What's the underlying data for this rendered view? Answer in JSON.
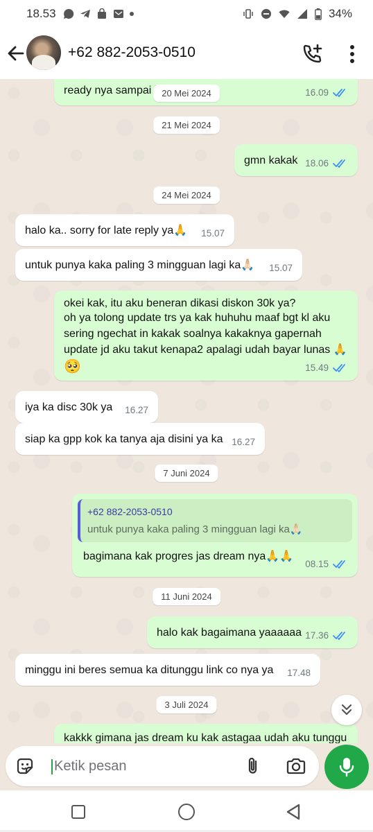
{
  "status_bar": {
    "time": "18.53",
    "battery": "34%"
  },
  "header": {
    "contact": "+62 882-2053-0510"
  },
  "dates": {
    "d1": "20 Mei 2024",
    "d2": "21 Mei 2024",
    "d3": "24 Mei 2024",
    "d4": "7 Juni 2024",
    "d5": "11 Juni 2024",
    "d6": "3 Juli 2024"
  },
  "messages": [
    {
      "dir": "out",
      "text": "ready nya sampai kapan?",
      "time": "16.09"
    },
    {
      "dir": "out",
      "text": "gmn kakak",
      "time": "18.06"
    },
    {
      "dir": "in",
      "text": "halo ka.. sorry for late reply ya🙏",
      "time": "15.07"
    },
    {
      "dir": "in",
      "text": "untuk punya kaka paling 3 mingguan lagi ka🙏🏻",
      "time": "15.07"
    },
    {
      "dir": "out",
      "lines": [
        "okei kak, itu aku beneran dikasi diskon 30k ya?",
        "oh ya tolong update trs ya kak huhuhu maaf bgt kl aku",
        "sering ngechat in kakak soalnya kakaknya gapernah",
        "update jd aku takut kenapa2 apalagi udah bayar lunas 🙏",
        "🥺"
      ],
      "time": "15.49"
    },
    {
      "dir": "in",
      "text": "iya ka disc 30k ya",
      "time": "16.27"
    },
    {
      "dir": "in",
      "text": "siap ka gpp kok ka tanya aja disini ya ka",
      "time": "16.27"
    },
    {
      "dir": "out",
      "quote_name": "+62 882-2053-0510",
      "quote_text": "untuk punya kaka paling 3 mingguan lagi ka🙏🏻",
      "text": "bagimana kak progres jas dream nya🙏🙏",
      "time": "08.15"
    },
    {
      "dir": "out",
      "text": "halo kak bagaimana yaaaaaa",
      "time": "17.36"
    },
    {
      "dir": "in",
      "text": "minggu ini beres semua ka ditunggu link co nya ya",
      "time": "17.48"
    },
    {
      "dir": "out",
      "text": "kakkk gimana jas dream ku kak astagaa udah aku tunggu"
    }
  ],
  "composer": {
    "placeholder": "Ketik pesan"
  },
  "colors": {
    "outgoing_bubble": "#d9fdd3",
    "incoming_bubble": "#ffffff",
    "accent_green": "#21a949",
    "read_ticks": "#3a8ef6"
  },
  "icons": [
    "back-arrow-icon",
    "add-call-icon",
    "more-vert-icon",
    "double-check-icon",
    "chevrons-down-icon",
    "sticker-icon",
    "attach-icon",
    "camera-icon",
    "mic-icon"
  ]
}
